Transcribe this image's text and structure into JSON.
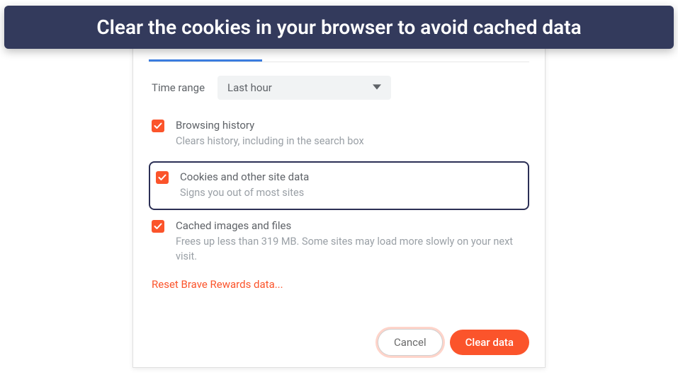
{
  "banner": "Clear the cookies in your browser to avoid cached data",
  "dialog": {
    "timeLabel": "Time range",
    "timeValue": "Last hour",
    "options": [
      {
        "title": "Browsing history",
        "desc": "Clears history, including in the search box",
        "checked": true,
        "highlighted": false
      },
      {
        "title": "Cookies and other site data",
        "desc": "Signs you out of most sites",
        "checked": true,
        "highlighted": true
      },
      {
        "title": "Cached images and files",
        "desc": "Frees up less than 319 MB. Some sites may load more slowly on your next visit.",
        "checked": true,
        "highlighted": false
      }
    ],
    "resetLink": "Reset Brave Rewards data...",
    "cancel": "Cancel",
    "clear": "Clear data"
  }
}
